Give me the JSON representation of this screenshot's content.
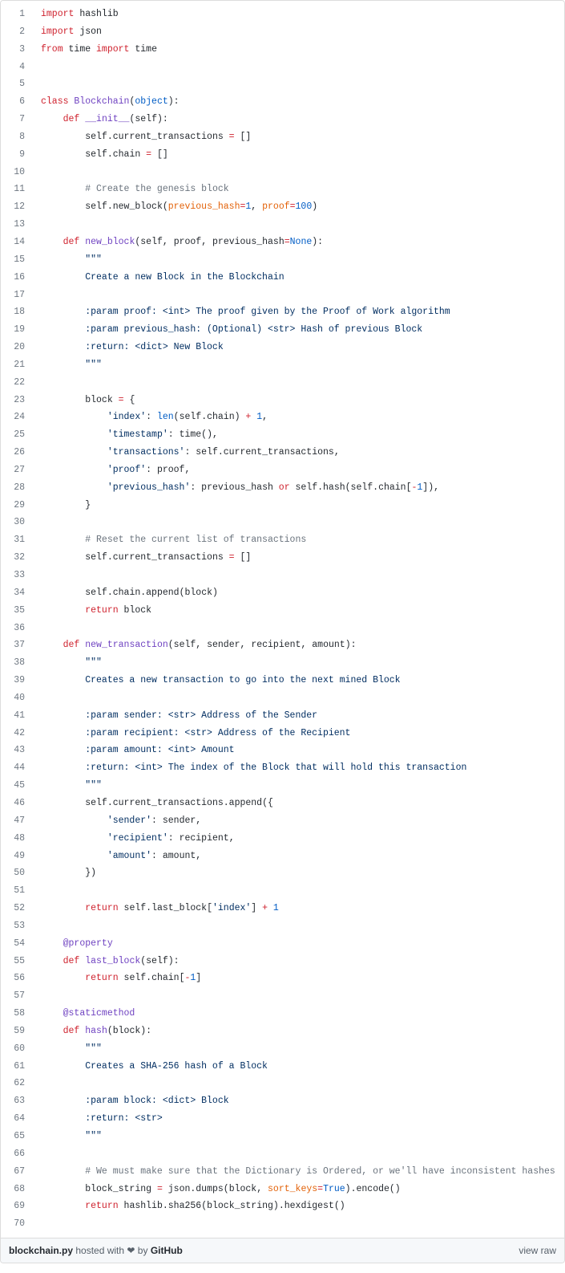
{
  "footer": {
    "filename": "blockchain.py",
    "hosted_with": " hosted with ",
    "heart": "❤",
    "by": " by ",
    "github": "GitHub",
    "view_raw": "view raw"
  },
  "lines": [
    {
      "n": 1,
      "h": "<span class='tk-kw'>import</span> <span class='tk-name'>hashlib</span>"
    },
    {
      "n": 2,
      "h": "<span class='tk-kw'>import</span> <span class='tk-name'>json</span>"
    },
    {
      "n": 3,
      "h": "<span class='tk-kw'>from</span> <span class='tk-name'>time</span> <span class='tk-kw'>import</span> <span class='tk-name'>time</span>"
    },
    {
      "n": 4,
      "h": ""
    },
    {
      "n": 5,
      "h": ""
    },
    {
      "n": 6,
      "h": "<span class='tk-kw'>class</span> <span class='tk-cls'>Blockchain</span>(<span class='tk-builtin'>object</span>):"
    },
    {
      "n": 7,
      "h": "    <span class='tk-kw'>def</span> <span class='tk-fn'>__init__</span>(<span class='tk-self'>self</span>):"
    },
    {
      "n": 8,
      "h": "        <span class='tk-self'>self</span>.<span class='tk-name'>current_transactions</span> <span class='tk-op'>=</span> []"
    },
    {
      "n": 9,
      "h": "        <span class='tk-self'>self</span>.<span class='tk-name'>chain</span> <span class='tk-op'>=</span> []"
    },
    {
      "n": 10,
      "h": ""
    },
    {
      "n": 11,
      "h": "        <span class='tk-com'># Create the genesis block</span>"
    },
    {
      "n": 12,
      "h": "        <span class='tk-self'>self</span>.<span class='tk-name'>new_block</span>(<span class='tk-var'>previous_hash</span><span class='tk-op'>=</span><span class='tk-num'>1</span>, <span class='tk-var'>proof</span><span class='tk-op'>=</span><span class='tk-num'>100</span>)"
    },
    {
      "n": 13,
      "h": ""
    },
    {
      "n": 14,
      "h": "    <span class='tk-kw'>def</span> <span class='tk-fn'>new_block</span>(<span class='tk-self'>self</span>, <span class='tk-name'>proof</span>, <span class='tk-name'>previous_hash</span><span class='tk-op'>=</span><span class='tk-bool'>None</span>):"
    },
    {
      "n": 15,
      "h": "        <span class='tk-str'>\"\"\"</span>"
    },
    {
      "n": 16,
      "h": "<span class='tk-str'>        Create a new Block in the Blockchain</span>"
    },
    {
      "n": 17,
      "h": "<span class='tk-str'></span>"
    },
    {
      "n": 18,
      "h": "<span class='tk-str'>        :param proof: &lt;int&gt; The proof given by the Proof of Work algorithm</span>"
    },
    {
      "n": 19,
      "h": "<span class='tk-str'>        :param previous_hash: (Optional) &lt;str&gt; Hash of previous Block</span>"
    },
    {
      "n": 20,
      "h": "<span class='tk-str'>        :return: &lt;dict&gt; New Block</span>"
    },
    {
      "n": 21,
      "h": "<span class='tk-str'>        \"\"\"</span>"
    },
    {
      "n": 22,
      "h": ""
    },
    {
      "n": 23,
      "h": "        <span class='tk-name'>block</span> <span class='tk-op'>=</span> {"
    },
    {
      "n": 24,
      "h": "            <span class='tk-str'>'index'</span>: <span class='tk-builtin'>len</span>(<span class='tk-self'>self</span>.<span class='tk-name'>chain</span>) <span class='tk-op'>+</span> <span class='tk-num'>1</span>,"
    },
    {
      "n": 25,
      "h": "            <span class='tk-str'>'timestamp'</span>: <span class='tk-name'>time</span>(),"
    },
    {
      "n": 26,
      "h": "            <span class='tk-str'>'transactions'</span>: <span class='tk-self'>self</span>.<span class='tk-name'>current_transactions</span>,"
    },
    {
      "n": 27,
      "h": "            <span class='tk-str'>'proof'</span>: <span class='tk-name'>proof</span>,"
    },
    {
      "n": 28,
      "h": "            <span class='tk-str'>'previous_hash'</span>: <span class='tk-name'>previous_hash</span> <span class='tk-kw'>or</span> <span class='tk-self'>self</span>.<span class='tk-name'>hash</span>(<span class='tk-self'>self</span>.<span class='tk-name'>chain</span>[<span class='tk-op'>-</span><span class='tk-num'>1</span>]),"
    },
    {
      "n": 29,
      "h": "        }"
    },
    {
      "n": 30,
      "h": ""
    },
    {
      "n": 31,
      "h": "        <span class='tk-com'># Reset the current list of transactions</span>"
    },
    {
      "n": 32,
      "h": "        <span class='tk-self'>self</span>.<span class='tk-name'>current_transactions</span> <span class='tk-op'>=</span> []"
    },
    {
      "n": 33,
      "h": ""
    },
    {
      "n": 34,
      "h": "        <span class='tk-self'>self</span>.<span class='tk-name'>chain</span>.<span class='tk-name'>append</span>(<span class='tk-name'>block</span>)"
    },
    {
      "n": 35,
      "h": "        <span class='tk-kw'>return</span> <span class='tk-name'>block</span>"
    },
    {
      "n": 36,
      "h": ""
    },
    {
      "n": 37,
      "h": "    <span class='tk-kw'>def</span> <span class='tk-fn'>new_transaction</span>(<span class='tk-self'>self</span>, <span class='tk-name'>sender</span>, <span class='tk-name'>recipient</span>, <span class='tk-name'>amount</span>):"
    },
    {
      "n": 38,
      "h": "        <span class='tk-str'>\"\"\"</span>"
    },
    {
      "n": 39,
      "h": "<span class='tk-str'>        Creates a new transaction to go into the next mined Block</span>"
    },
    {
      "n": 40,
      "h": "<span class='tk-str'></span>"
    },
    {
      "n": 41,
      "h": "<span class='tk-str'>        :param sender: &lt;str&gt; Address of the Sender</span>"
    },
    {
      "n": 42,
      "h": "<span class='tk-str'>        :param recipient: &lt;str&gt; Address of the Recipient</span>"
    },
    {
      "n": 43,
      "h": "<span class='tk-str'>        :param amount: &lt;int&gt; Amount</span>"
    },
    {
      "n": 44,
      "h": "<span class='tk-str'>        :return: &lt;int&gt; The index of the Block that will hold this transaction</span>"
    },
    {
      "n": 45,
      "h": "<span class='tk-str'>        \"\"\"</span>"
    },
    {
      "n": 46,
      "h": "        <span class='tk-self'>self</span>.<span class='tk-name'>current_transactions</span>.<span class='tk-name'>append</span>({"
    },
    {
      "n": 47,
      "h": "            <span class='tk-str'>'sender'</span>: <span class='tk-name'>sender</span>,"
    },
    {
      "n": 48,
      "h": "            <span class='tk-str'>'recipient'</span>: <span class='tk-name'>recipient</span>,"
    },
    {
      "n": 49,
      "h": "            <span class='tk-str'>'amount'</span>: <span class='tk-name'>amount</span>,"
    },
    {
      "n": 50,
      "h": "        })"
    },
    {
      "n": 51,
      "h": ""
    },
    {
      "n": 52,
      "h": "        <span class='tk-kw'>return</span> <span class='tk-self'>self</span>.<span class='tk-name'>last_block</span>[<span class='tk-str'>'index'</span>] <span class='tk-op'>+</span> <span class='tk-num'>1</span>"
    },
    {
      "n": 53,
      "h": ""
    },
    {
      "n": 54,
      "h": "    <span class='tk-dec'>@property</span>"
    },
    {
      "n": 55,
      "h": "    <span class='tk-kw'>def</span> <span class='tk-fn'>last_block</span>(<span class='tk-self'>self</span>):"
    },
    {
      "n": 56,
      "h": "        <span class='tk-kw'>return</span> <span class='tk-self'>self</span>.<span class='tk-name'>chain</span>[<span class='tk-op'>-</span><span class='tk-num'>1</span>]"
    },
    {
      "n": 57,
      "h": ""
    },
    {
      "n": 58,
      "h": "    <span class='tk-dec'>@staticmethod</span>"
    },
    {
      "n": 59,
      "h": "    <span class='tk-kw'>def</span> <span class='tk-fn'>hash</span>(<span class='tk-name'>block</span>):"
    },
    {
      "n": 60,
      "h": "        <span class='tk-str'>\"\"\"</span>"
    },
    {
      "n": 61,
      "h": "<span class='tk-str'>        Creates a SHA-256 hash of a Block</span>"
    },
    {
      "n": 62,
      "h": "<span class='tk-str'></span>"
    },
    {
      "n": 63,
      "h": "<span class='tk-str'>        :param block: &lt;dict&gt; Block</span>"
    },
    {
      "n": 64,
      "h": "<span class='tk-str'>        :return: &lt;str&gt;</span>"
    },
    {
      "n": 65,
      "h": "<span class='tk-str'>        \"\"\"</span>"
    },
    {
      "n": 66,
      "h": ""
    },
    {
      "n": 67,
      "h": "        <span class='tk-com'># We must make sure that the Dictionary is Ordered, or we'll have inconsistent hashes</span>"
    },
    {
      "n": 68,
      "h": "        <span class='tk-name'>block_string</span> <span class='tk-op'>=</span> <span class='tk-name'>json</span>.<span class='tk-name'>dumps</span>(<span class='tk-name'>block</span>, <span class='tk-var'>sort_keys</span><span class='tk-op'>=</span><span class='tk-bool'>True</span>).<span class='tk-name'>encode</span>()"
    },
    {
      "n": 69,
      "h": "        <span class='tk-kw'>return</span> <span class='tk-name'>hashlib</span>.<span class='tk-name'>sha256</span>(<span class='tk-name'>block_string</span>).<span class='tk-name'>hexdigest</span>()"
    },
    {
      "n": 70,
      "h": ""
    }
  ]
}
